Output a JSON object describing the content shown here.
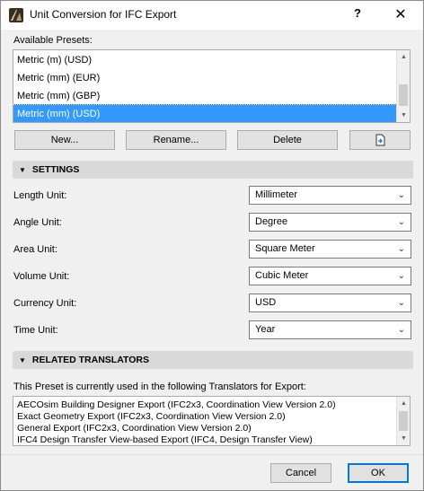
{
  "window": {
    "title": "Unit Conversion for IFC Export",
    "help_label": "?",
    "close_label": "✕"
  },
  "presets": {
    "label": "Available Presets:",
    "items": [
      {
        "label": "Metric (m) (USD)"
      },
      {
        "label": "Metric (mm) (EUR)"
      },
      {
        "label": "Metric (mm) (GBP)"
      },
      {
        "label": "Metric (mm) (USD)"
      }
    ],
    "selected_index": 3,
    "buttons": {
      "new": "New...",
      "rename": "Rename...",
      "delete": "Delete",
      "export_icon": "export-icon"
    }
  },
  "settings": {
    "header": "SETTINGS",
    "rows": [
      {
        "label": "Length Unit:",
        "value": "Millimeter"
      },
      {
        "label": "Angle Unit:",
        "value": "Degree"
      },
      {
        "label": "Area Unit:",
        "value": "Square Meter"
      },
      {
        "label": "Volume Unit:",
        "value": "Cubic Meter"
      },
      {
        "label": "Currency Unit:",
        "value": "USD"
      },
      {
        "label": "Time Unit:",
        "value": "Year"
      }
    ]
  },
  "related": {
    "header": "RELATED TRANSLATORS",
    "description": "This Preset is currently used in the following Translators for Export:",
    "translators": [
      "AECOsim Building Designer Export (IFC2x3, Coordination View Version 2.0)",
      "Exact Geometry Export (IFC2x3, Coordination View Version 2.0)",
      "General Export (IFC2x3, Coordination View Version 2.0)",
      "IFC4 Design Transfer View-based Export (IFC4, Design Transfer View)"
    ]
  },
  "footer": {
    "cancel": "Cancel",
    "ok": "OK"
  },
  "colors": {
    "selection": "#3399ff",
    "accent": "#0078d7",
    "group_header": "#d9d9d9"
  }
}
